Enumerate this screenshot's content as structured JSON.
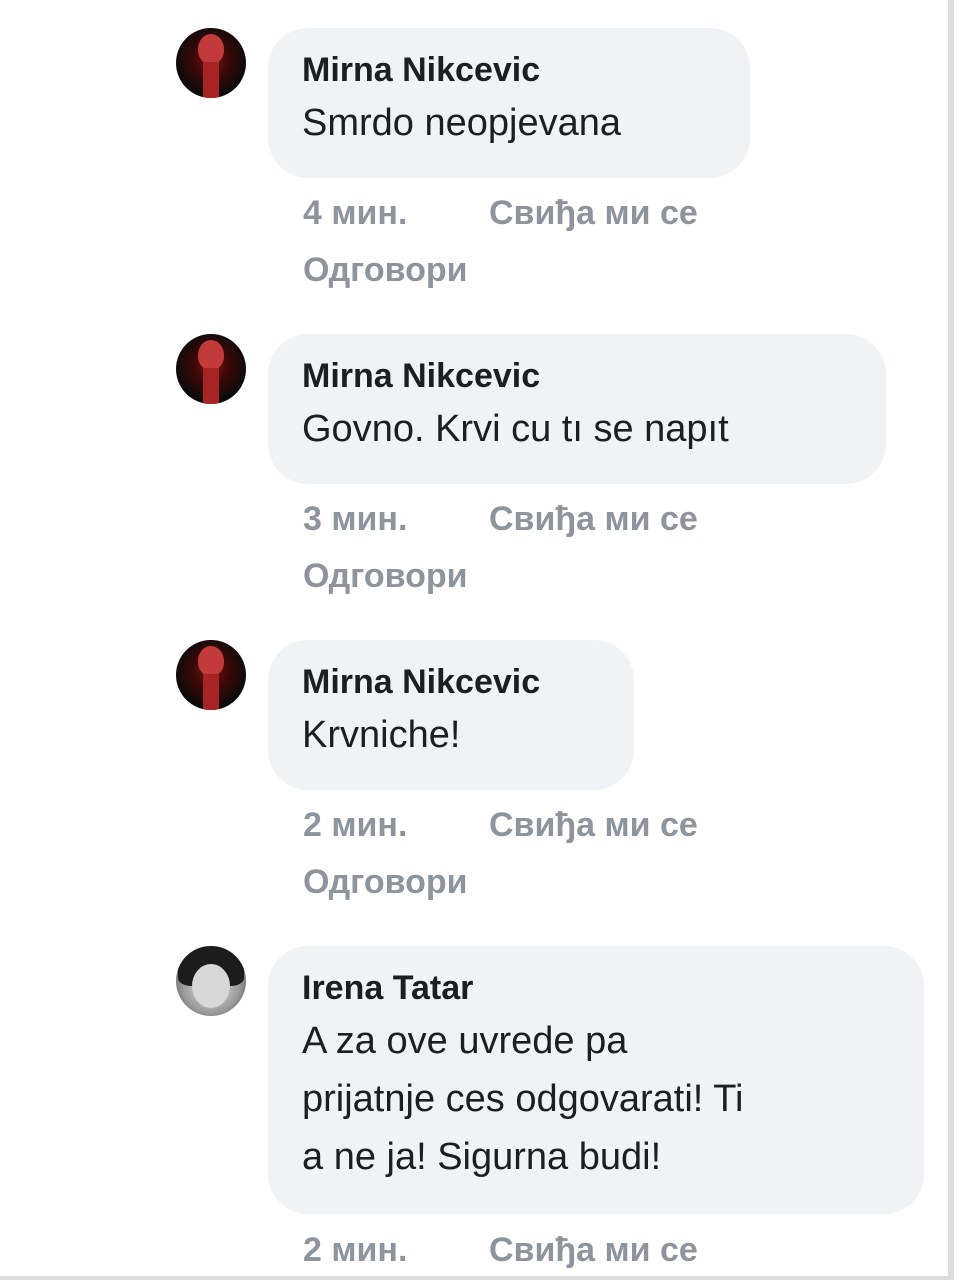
{
  "comments": [
    {
      "author": "Mirna Nikcevic",
      "text": "Smrdo neopjevana",
      "time": "4 мин.",
      "like": "Свиђа ми се",
      "reply": "Одговори",
      "avatar": "dark-red-portrait"
    },
    {
      "author": "Mirna Nikcevic",
      "text": "Govno. Krvi cu tı se napıt",
      "time": "3 мин.",
      "like": "Свиђа ми се",
      "reply": "Одговори",
      "avatar": "dark-red-portrait"
    },
    {
      "author": "Mirna Nikcevic",
      "text": "Krvniche!",
      "time": "2 мин.",
      "like": "Свиђа ми се",
      "reply": "Одговори",
      "avatar": "dark-red-portrait"
    },
    {
      "author": "Irena Tatar",
      "text_lines": [
        "A za ove uvrede pa",
        "prijatnje ces odgovarati! Ti",
        "a ne ja! Sigurna budi!"
      ],
      "time": "2 мин.",
      "like": "Свиђа ми се",
      "avatar": "grayscale-portrait"
    }
  ],
  "colors": {
    "bubble": "#f0f2f5",
    "author": "#1c1e21",
    "meta": "#8d949e"
  }
}
